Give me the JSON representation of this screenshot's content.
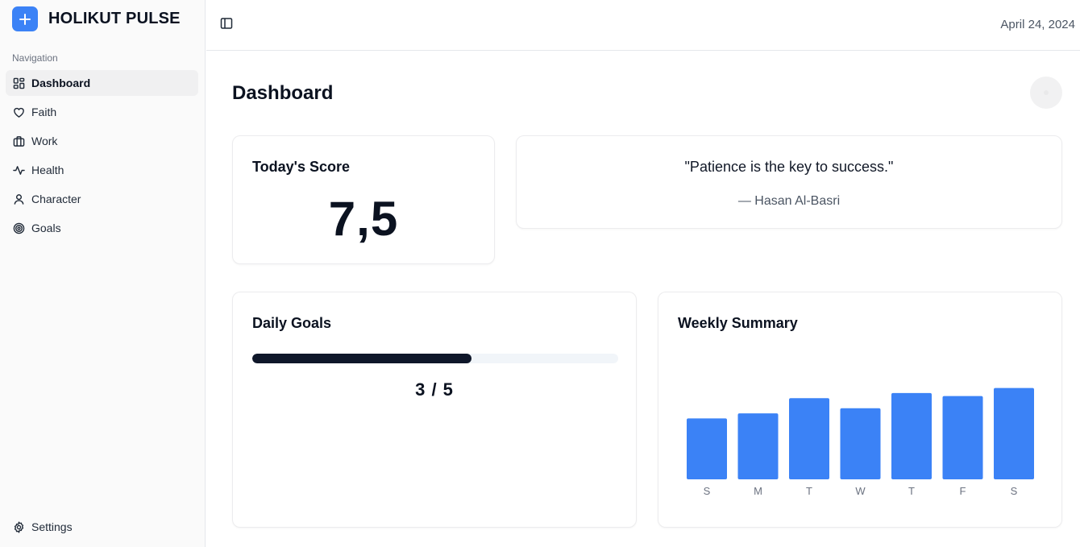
{
  "brand": {
    "name": "HOLIKUT PULSE"
  },
  "sidebar": {
    "heading": "Navigation",
    "items": [
      {
        "label": "Dashboard",
        "icon": "dashboard-icon",
        "active": true
      },
      {
        "label": "Faith",
        "icon": "heart-icon",
        "active": false
      },
      {
        "label": "Work",
        "icon": "briefcase-icon",
        "active": false
      },
      {
        "label": "Health",
        "icon": "activity-icon",
        "active": false
      },
      {
        "label": "Character",
        "icon": "user-icon",
        "active": false
      },
      {
        "label": "Goals",
        "icon": "target-icon",
        "active": false
      }
    ],
    "settings_label": "Settings"
  },
  "header": {
    "date": "April 24, 2024"
  },
  "main": {
    "title": "Dashboard",
    "score": {
      "title": "Today's Score",
      "value": "7,5"
    },
    "quote": {
      "text": "\"Patience is the key to success.\"",
      "author": "— Hasan Al-Basri"
    },
    "goals": {
      "title": "Daily Goals",
      "completed": 3,
      "total": 5,
      "label": "3 / 5",
      "progress": 0.6
    },
    "weekly": {
      "title": "Weekly Summary"
    }
  },
  "colors": {
    "accent": "#3b82f6",
    "progress": "#0f172a"
  },
  "chart_data": {
    "type": "bar",
    "title": "Weekly Summary",
    "categories": [
      "S",
      "M",
      "T",
      "W",
      "T",
      "F",
      "S"
    ],
    "values": [
      6.0,
      6.5,
      8.0,
      7.0,
      8.5,
      8.2,
      9.0
    ],
    "ylim": [
      0,
      10
    ],
    "grid": false,
    "color": "#3b82f6"
  }
}
